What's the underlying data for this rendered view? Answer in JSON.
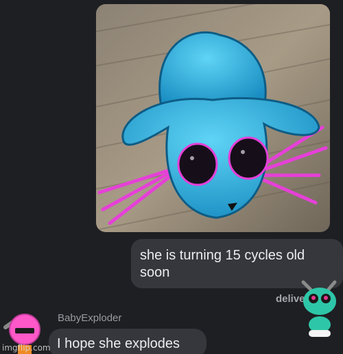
{
  "messages": {
    "outgoing_text": "she is turning 15 cycles old soon",
    "status": "delive",
    "sender_name": "BabyExploder",
    "incoming_text": "I hope she explodes"
  },
  "watermark": "imgflip.com",
  "icons": {
    "photo": "axolotl-creature-photo",
    "left_avatar": "pink-round-character-icon",
    "right_avatar": "teal-alien-character-icon"
  },
  "colors": {
    "background": "#1e1f22",
    "bubble": "#36373c",
    "creature": "#2bb6e8",
    "gills": "#e640d8"
  }
}
